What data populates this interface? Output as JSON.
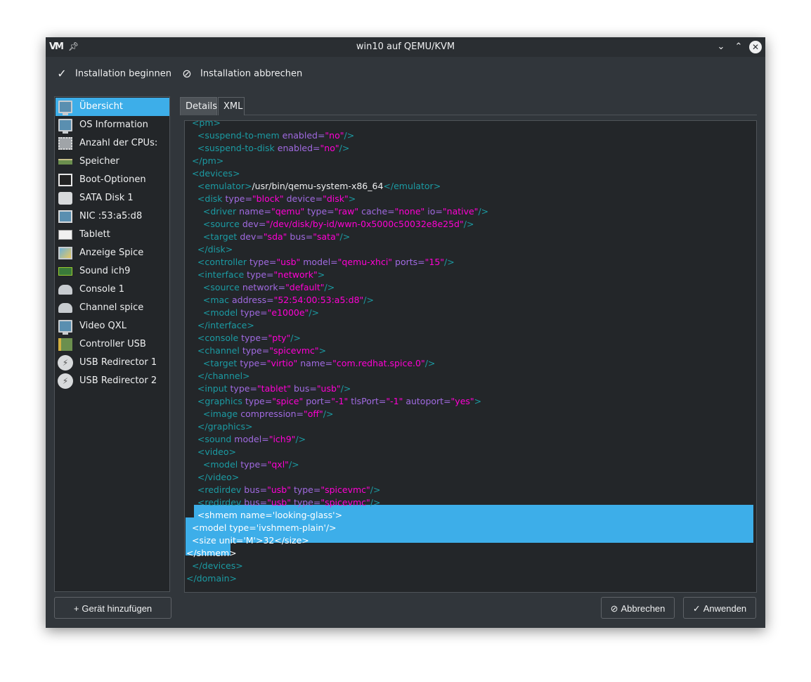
{
  "window": {
    "title": "win10 auf QEMU/KVM",
    "logo": "VM",
    "pin_icon": "pin-icon",
    "controls": [
      "minimize-icon",
      "maximize-icon",
      "close-icon"
    ]
  },
  "toolbar": {
    "begin_label": "Installation beginnen",
    "begin_icon": "checkmark-icon",
    "abort_label": "Installation abbrechen",
    "abort_icon": "cancel-icon"
  },
  "sidebar": {
    "items": [
      {
        "label": "Übersicht",
        "icon": "monitor-icon",
        "selected": true
      },
      {
        "label": "OS Information",
        "icon": "monitor-icon"
      },
      {
        "label": "Anzahl der CPUs:",
        "icon": "cpu-icon"
      },
      {
        "label": "Speicher",
        "icon": "memory-icon"
      },
      {
        "label": "Boot-Optionen",
        "icon": "boot-icon"
      },
      {
        "label": "SATA Disk 1",
        "icon": "disk-icon"
      },
      {
        "label": "NIC :53:a5:d8",
        "icon": "network-icon"
      },
      {
        "label": "Tablett",
        "icon": "tablet-icon"
      },
      {
        "label": "Anzeige Spice",
        "icon": "display-icon"
      },
      {
        "label": "Sound ich9",
        "icon": "soundcard-icon"
      },
      {
        "label": "Console 1",
        "icon": "serial-icon"
      },
      {
        "label": "Channel spice",
        "icon": "serial-icon"
      },
      {
        "label": "Video QXL",
        "icon": "monitor-icon"
      },
      {
        "label": "Controller USB",
        "icon": "usb-controller-icon"
      },
      {
        "label": "USB Redirector 1",
        "icon": "usb-icon"
      },
      {
        "label": "USB Redirector 2",
        "icon": "usb-icon"
      }
    ],
    "add_button_label": "Gerät hinzufügen"
  },
  "tabs": [
    {
      "label": "Details",
      "active": false
    },
    {
      "label": "XML",
      "active": true
    }
  ],
  "editor": {
    "lines": [
      {
        "indent": "  ",
        "parts": [
          [
            "t",
            "<pm>"
          ]
        ]
      },
      {
        "indent": "    ",
        "parts": [
          [
            "t",
            "<suspend-to-mem "
          ],
          [
            "a",
            "enabled="
          ],
          [
            "v",
            "\"no\""
          ],
          [
            "t",
            "/>"
          ]
        ]
      },
      {
        "indent": "    ",
        "parts": [
          [
            "t",
            "<suspend-to-disk "
          ],
          [
            "a",
            "enabled="
          ],
          [
            "v",
            "\"no\""
          ],
          [
            "t",
            "/>"
          ]
        ]
      },
      {
        "indent": "  ",
        "parts": [
          [
            "t",
            "</pm>"
          ]
        ]
      },
      {
        "indent": "  ",
        "parts": [
          [
            "t",
            "<devices>"
          ]
        ]
      },
      {
        "indent": "    ",
        "parts": [
          [
            "t",
            "<emulator>"
          ],
          [
            "x",
            "/usr/bin/qemu-system-x86_64"
          ],
          [
            "t",
            "</emulator>"
          ]
        ]
      },
      {
        "indent": "    ",
        "parts": [
          [
            "t",
            "<disk "
          ],
          [
            "a",
            "type="
          ],
          [
            "v",
            "\"block\" "
          ],
          [
            "a",
            "device="
          ],
          [
            "v",
            "\"disk\""
          ],
          [
            "t",
            ">"
          ]
        ]
      },
      {
        "indent": "      ",
        "parts": [
          [
            "t",
            "<driver "
          ],
          [
            "a",
            "name="
          ],
          [
            "v",
            "\"qemu\" "
          ],
          [
            "a",
            "type="
          ],
          [
            "v",
            "\"raw\" "
          ],
          [
            "a",
            "cache="
          ],
          [
            "v",
            "\"none\" "
          ],
          [
            "a",
            "io="
          ],
          [
            "v",
            "\"native\""
          ],
          [
            "t",
            "/>"
          ]
        ]
      },
      {
        "indent": "      ",
        "parts": [
          [
            "t",
            "<source "
          ],
          [
            "a",
            "dev="
          ],
          [
            "v",
            "\"/dev/disk/by-id/wwn-0x5000c50032e8e25d\""
          ],
          [
            "t",
            "/>"
          ]
        ]
      },
      {
        "indent": "      ",
        "parts": [
          [
            "t",
            "<target "
          ],
          [
            "a",
            "dev="
          ],
          [
            "v",
            "\"sda\" "
          ],
          [
            "a",
            "bus="
          ],
          [
            "v",
            "\"sata\""
          ],
          [
            "t",
            "/>"
          ]
        ]
      },
      {
        "indent": "    ",
        "parts": [
          [
            "t",
            "</disk>"
          ]
        ]
      },
      {
        "indent": "    ",
        "parts": [
          [
            "t",
            "<controller "
          ],
          [
            "a",
            "type="
          ],
          [
            "v",
            "\"usb\" "
          ],
          [
            "a",
            "model="
          ],
          [
            "v",
            "\"qemu-xhci\" "
          ],
          [
            "a",
            "ports="
          ],
          [
            "v",
            "\"15\""
          ],
          [
            "t",
            "/>"
          ]
        ]
      },
      {
        "indent": "    ",
        "parts": [
          [
            "t",
            "<interface "
          ],
          [
            "a",
            "type="
          ],
          [
            "v",
            "\"network\""
          ],
          [
            "t",
            ">"
          ]
        ]
      },
      {
        "indent": "      ",
        "parts": [
          [
            "t",
            "<source "
          ],
          [
            "a",
            "network="
          ],
          [
            "v",
            "\"default\""
          ],
          [
            "t",
            "/>"
          ]
        ]
      },
      {
        "indent": "      ",
        "parts": [
          [
            "t",
            "<mac "
          ],
          [
            "a",
            "address="
          ],
          [
            "v",
            "\"52:54:00:53:a5:d8\""
          ],
          [
            "t",
            "/>"
          ]
        ]
      },
      {
        "indent": "      ",
        "parts": [
          [
            "t",
            "<model "
          ],
          [
            "a",
            "type="
          ],
          [
            "v",
            "\"e1000e\""
          ],
          [
            "t",
            "/>"
          ]
        ]
      },
      {
        "indent": "    ",
        "parts": [
          [
            "t",
            "</interface>"
          ]
        ]
      },
      {
        "indent": "    ",
        "parts": [
          [
            "t",
            "<console "
          ],
          [
            "a",
            "type="
          ],
          [
            "v",
            "\"pty\""
          ],
          [
            "t",
            "/>"
          ]
        ]
      },
      {
        "indent": "    ",
        "parts": [
          [
            "t",
            "<channel "
          ],
          [
            "a",
            "type="
          ],
          [
            "v",
            "\"spicevmc\""
          ],
          [
            "t",
            ">"
          ]
        ]
      },
      {
        "indent": "      ",
        "parts": [
          [
            "t",
            "<target "
          ],
          [
            "a",
            "type="
          ],
          [
            "v",
            "\"virtio\" "
          ],
          [
            "a",
            "name="
          ],
          [
            "v",
            "\"com.redhat.spice.0\""
          ],
          [
            "t",
            "/>"
          ]
        ]
      },
      {
        "indent": "    ",
        "parts": [
          [
            "t",
            "</channel>"
          ]
        ]
      },
      {
        "indent": "    ",
        "parts": [
          [
            "t",
            "<input "
          ],
          [
            "a",
            "type="
          ],
          [
            "v",
            "\"tablet\" "
          ],
          [
            "a",
            "bus="
          ],
          [
            "v",
            "\"usb\""
          ],
          [
            "t",
            "/>"
          ]
        ]
      },
      {
        "indent": "    ",
        "parts": [
          [
            "t",
            "<graphics "
          ],
          [
            "a",
            "type="
          ],
          [
            "v",
            "\"spice\" "
          ],
          [
            "a",
            "port="
          ],
          [
            "v",
            "\"-1\" "
          ],
          [
            "a",
            "tlsPort="
          ],
          [
            "v",
            "\"-1\" "
          ],
          [
            "a",
            "autoport="
          ],
          [
            "v",
            "\"yes\""
          ],
          [
            "t",
            ">"
          ]
        ]
      },
      {
        "indent": "      ",
        "parts": [
          [
            "t",
            "<image "
          ],
          [
            "a",
            "compression="
          ],
          [
            "v",
            "\"off\""
          ],
          [
            "t",
            "/>"
          ]
        ]
      },
      {
        "indent": "    ",
        "parts": [
          [
            "t",
            "</graphics>"
          ]
        ]
      },
      {
        "indent": "    ",
        "parts": [
          [
            "t",
            "<sound "
          ],
          [
            "a",
            "model="
          ],
          [
            "v",
            "\"ich9\""
          ],
          [
            "t",
            "/>"
          ]
        ]
      },
      {
        "indent": "    ",
        "parts": [
          [
            "t",
            "<video>"
          ]
        ]
      },
      {
        "indent": "      ",
        "parts": [
          [
            "t",
            "<model "
          ],
          [
            "a",
            "type="
          ],
          [
            "v",
            "\"qxl\""
          ],
          [
            "t",
            "/>"
          ]
        ]
      },
      {
        "indent": "    ",
        "parts": [
          [
            "t",
            "</video>"
          ]
        ]
      },
      {
        "indent": "    ",
        "parts": [
          [
            "t",
            "<redirdev "
          ],
          [
            "a",
            "bus="
          ],
          [
            "v",
            "\"usb\" "
          ],
          [
            "a",
            "type="
          ],
          [
            "v",
            "\"spicevmc\""
          ],
          [
            "t",
            "/>"
          ]
        ]
      },
      {
        "indent": "    ",
        "parts": [
          [
            "t",
            "<redirdev "
          ],
          [
            "a",
            "bus="
          ],
          [
            "v",
            "\"usb\" "
          ],
          [
            "a",
            "type="
          ],
          [
            "v",
            "\"spicevmc\""
          ],
          [
            "t",
            "/>"
          ]
        ]
      },
      {
        "indent": "    ",
        "parts": [
          [
            "h",
            "<shmem name='looking-glass'>"
          ]
        ]
      },
      {
        "indent": "  ",
        "parts": [
          [
            "h",
            "<model type='ivshmem-plain'/>"
          ]
        ]
      },
      {
        "indent": "  ",
        "parts": [
          [
            "h",
            "<size unit='M'>32</size>"
          ]
        ]
      },
      {
        "indent": "",
        "parts": [
          [
            "h",
            "</shmem>"
          ]
        ]
      },
      {
        "indent": "  ",
        "parts": [
          [
            "t",
            "</devices>"
          ]
        ]
      },
      {
        "indent": "",
        "parts": [
          [
            "t",
            "</domain>"
          ]
        ]
      }
    ]
  },
  "buttons": {
    "cancel_label": "Abbrechen",
    "cancel_icon": "cancel-icon",
    "apply_label": "Anwenden",
    "apply_icon": "checkmark-icon"
  },
  "colors": {
    "window_bg": "#31363b",
    "view_bg": "#232629",
    "selection": "#3daee9",
    "xml_tag": "#1b9ba3",
    "xml_attr": "#a06ae0",
    "xml_value": "#ff00d4"
  }
}
